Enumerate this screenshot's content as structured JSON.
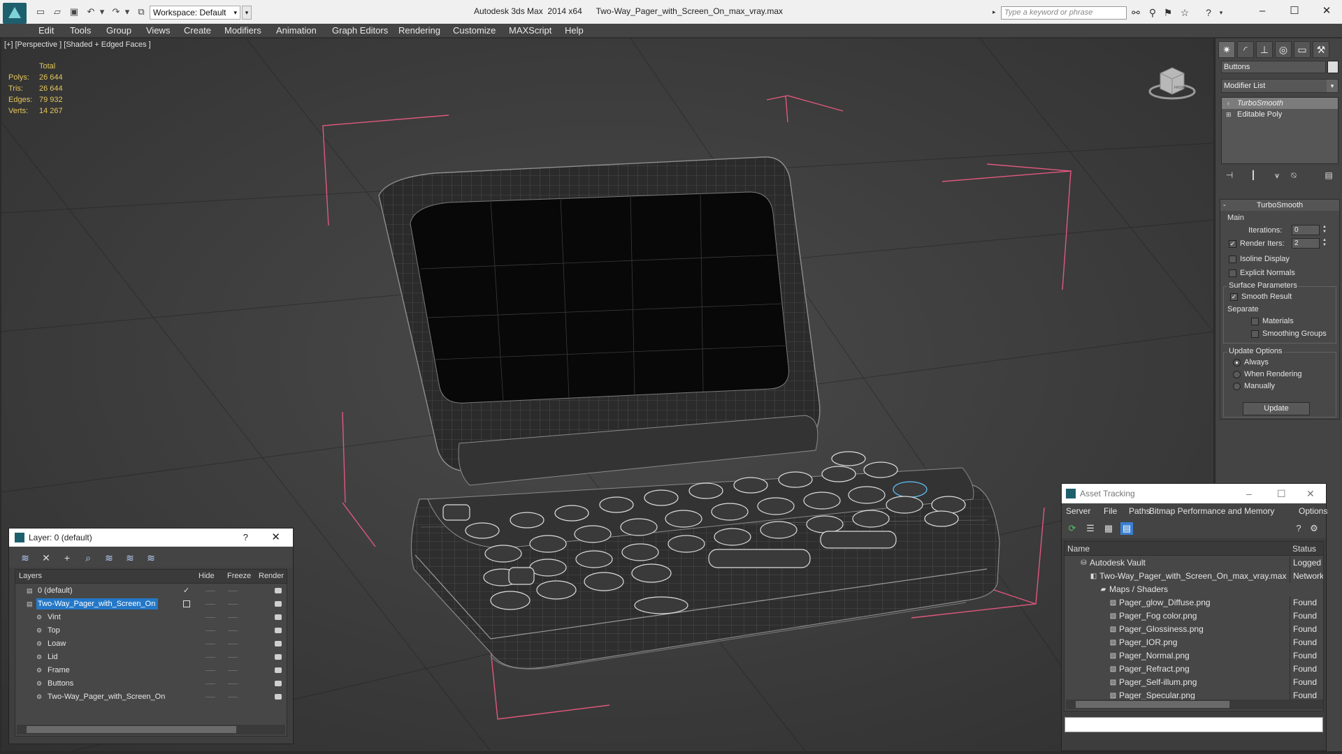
{
  "app": {
    "title": "Autodesk 3ds Max  2014 x64",
    "file": "Two-Way_Pager_with_Screen_On_max_vray.max",
    "workspace": "Workspace: Default",
    "search_placeholder": "Type a keyword or phrase"
  },
  "menu": [
    "Edit",
    "Tools",
    "Group",
    "Views",
    "Create",
    "Modifiers",
    "Animation",
    "Graph Editors",
    "Rendering",
    "Customize",
    "MAXScript",
    "Help"
  ],
  "viewport": {
    "label": "[+] [Perspective ] [Shaded + Edged Faces ]",
    "stats_header": "Total",
    "stats": [
      {
        "label": "Polys:",
        "value": "26 644"
      },
      {
        "label": "Tris:",
        "value": "26 644"
      },
      {
        "label": "Edges:",
        "value": "79 932"
      },
      {
        "label": "Verts:",
        "value": "14 267"
      }
    ],
    "viewcube_face": "FRONT"
  },
  "command_panel": {
    "object_name": "Buttons",
    "modifier_list": "Modifier List",
    "stack": [
      {
        "label": "TurboSmooth",
        "selected": true
      },
      {
        "label": "Editable Poly",
        "selected": false
      }
    ],
    "turbosmooth": {
      "title": "TurboSmooth",
      "main_label": "Main",
      "iterations_label": "Iterations:",
      "iterations_value": "0",
      "render_iters_label": "Render Iters:",
      "render_iters_value": "2",
      "isoline_label": "Isoline Display",
      "explicit_normals_label": "Explicit Normals",
      "surface_params_label": "Surface Parameters",
      "smooth_result_label": "Smooth Result",
      "separate_label": "Separate",
      "materials_label": "Materials",
      "smoothing_groups_label": "Smoothing Groups",
      "update_options_label": "Update Options",
      "always_label": "Always",
      "when_rendering_label": "When Rendering",
      "manually_label": "Manually",
      "update_button": "Update"
    }
  },
  "layer_window": {
    "title": "Layer: 0 (default)",
    "help": "?",
    "columns": {
      "layers": "Layers",
      "hide": "Hide",
      "freeze": "Freeze",
      "render": "Render"
    },
    "rows": [
      {
        "name": "0 (default)",
        "indent": 0,
        "kind": "layer",
        "mark": "check",
        "selected": false
      },
      {
        "name": "Two-Way_Pager_with_Screen_On",
        "indent": 0,
        "kind": "layer",
        "mark": "box",
        "selected": true
      },
      {
        "name": "Vint",
        "indent": 1,
        "kind": "object",
        "mark": "",
        "selected": false
      },
      {
        "name": "Top",
        "indent": 1,
        "kind": "object",
        "mark": "",
        "selected": false
      },
      {
        "name": "Loaw",
        "indent": 1,
        "kind": "object",
        "mark": "",
        "selected": false
      },
      {
        "name": "Lid",
        "indent": 1,
        "kind": "object",
        "mark": "",
        "selected": false
      },
      {
        "name": "Frame",
        "indent": 1,
        "kind": "object",
        "mark": "",
        "selected": false
      },
      {
        "name": "Buttons",
        "indent": 1,
        "kind": "object",
        "mark": "",
        "selected": false
      },
      {
        "name": "Two-Way_Pager_with_Screen_On",
        "indent": 1,
        "kind": "object",
        "mark": "",
        "selected": false
      }
    ]
  },
  "asset_window": {
    "title": "Asset Tracking",
    "menu": [
      "Server",
      "File",
      "Paths",
      "Bitmap Performance and Memory",
      "Options"
    ],
    "columns": {
      "name": "Name",
      "status": "Status"
    },
    "rows": [
      {
        "name": "Autodesk Vault",
        "indent": 0,
        "status": "Logged O"
      },
      {
        "name": "Two-Way_Pager_with_Screen_On_max_vray.max",
        "indent": 1,
        "status": "Network P"
      },
      {
        "name": "Maps / Shaders",
        "indent": 2,
        "status": ""
      },
      {
        "name": "Pager_glow_Diffuse.png",
        "indent": 3,
        "status": "Found"
      },
      {
        "name": "Pager_Fog color.png",
        "indent": 3,
        "status": "Found"
      },
      {
        "name": "Pager_Glossiness.png",
        "indent": 3,
        "status": "Found"
      },
      {
        "name": "Pager_IOR.png",
        "indent": 3,
        "status": "Found"
      },
      {
        "name": "Pager_Normal.png",
        "indent": 3,
        "status": "Found"
      },
      {
        "name": "Pager_Refract.png",
        "indent": 3,
        "status": "Found"
      },
      {
        "name": "Pager_Self-illum.png",
        "indent": 3,
        "status": "Found"
      },
      {
        "name": "Pager_Specular.png",
        "indent": 3,
        "status": "Found"
      }
    ]
  },
  "colors": {
    "stats_text": "#e3c65a",
    "selection": "#2478c8",
    "bounding_box": "#e0587e",
    "wire": "#9a9a9a"
  }
}
